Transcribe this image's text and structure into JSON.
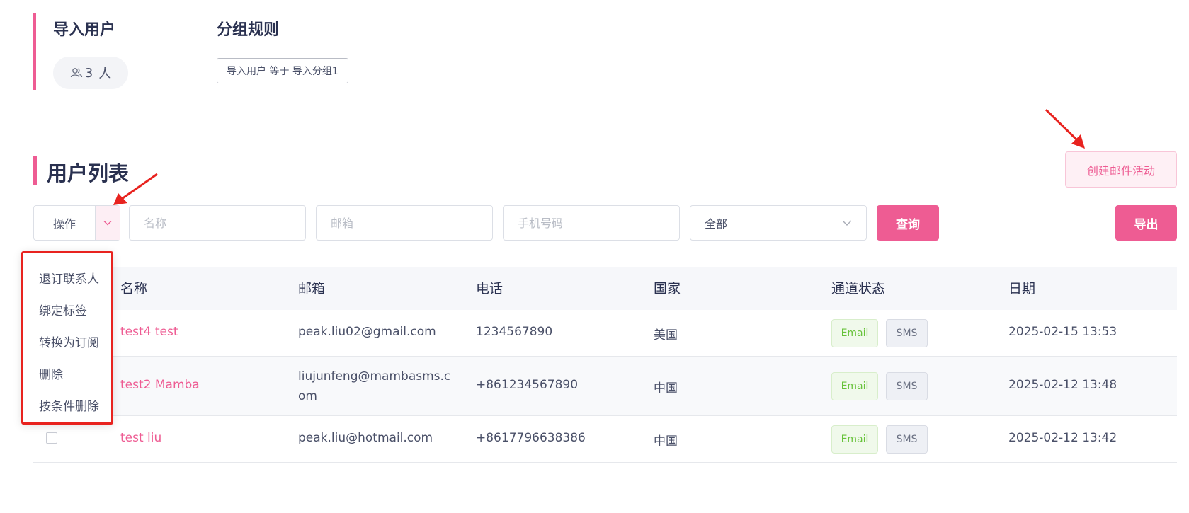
{
  "summary": {
    "import_title": "导入用户",
    "user_count": "3",
    "user_unit": "人",
    "rule_title": "分组规则",
    "rule_tag": "导入用户 等于 导入分组1"
  },
  "section": {
    "title": "用户列表",
    "create_campaign": "创建邮件活动"
  },
  "filters": {
    "operation_label": "操作",
    "name_placeholder": "名称",
    "email_placeholder": "邮箱",
    "phone_placeholder": "手机号码",
    "status_select": "全部",
    "query_button": "查询",
    "export_button": "导出"
  },
  "dropdown": {
    "items": [
      "退订联系人",
      "绑定标签",
      "转换为订阅",
      "删除",
      "按条件删除"
    ]
  },
  "table": {
    "columns": [
      "名称",
      "邮箱",
      "电话",
      "国家",
      "通道状态",
      "日期"
    ],
    "rows": [
      {
        "name": "test4 test",
        "email": "peak.liu02@gmail.com",
        "phone": "1234567890",
        "country": "美国",
        "channel_email": "Email",
        "channel_sms": "SMS",
        "date": "2025-02-15 13:53"
      },
      {
        "name": "test2 Mamba",
        "email": "liujunfeng@mambasms.com",
        "phone": "+861234567890",
        "country": "中国",
        "channel_email": "Email",
        "channel_sms": "SMS",
        "date": "2025-02-12 13:48"
      },
      {
        "name": "test liu",
        "email": "peak.liu@hotmail.com",
        "phone": "+8617796638386",
        "country": "中国",
        "channel_email": "Email",
        "channel_sms": "SMS",
        "date": "2025-02-12 13:42"
      }
    ]
  },
  "colors": {
    "accent": "#ee5c93",
    "annotation_red": "#e8231f",
    "email_chip_text": "#67c23a"
  }
}
